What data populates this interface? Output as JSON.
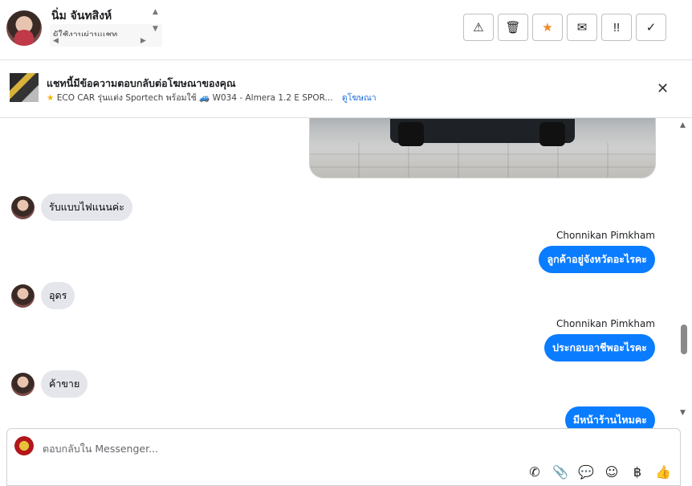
{
  "header": {
    "contact_name": "นิ่ม จันทสิงห์",
    "contact_subtext": "ผู้ใช้งานผ่านแชท",
    "actions": [
      {
        "name": "report-spam-button",
        "icon": "warning-icon",
        "glyph": "⚠"
      },
      {
        "name": "delete-button",
        "icon": "trash-icon",
        "glyph": "🗑"
      },
      {
        "name": "star-button",
        "icon": "star-icon",
        "glyph": "★"
      },
      {
        "name": "mark-unread-button",
        "icon": "envelope-open-icon",
        "glyph": "✉"
      },
      {
        "name": "follow-up-button",
        "icon": "follow-up-icon",
        "glyph": "!!"
      },
      {
        "name": "mark-done-button",
        "icon": "check-icon",
        "glyph": "✓"
      }
    ]
  },
  "ad_banner": {
    "title": "แชทนี้มีข้อความตอบกลับต่อโฆษณาของคุณ",
    "star_icon": "★",
    "ad_name": "ECO CAR รุ่นแต่ง Sportech พร้อมใช้",
    "car_icon": "🚙",
    "ad_detail": "W034 - Almera 1.2 E SPOR...",
    "link": "ดูโฆษณา",
    "close_glyph": "✕"
  },
  "messages": [
    {
      "direction": "in",
      "text": "รับแบบไฟแนนค่ะ"
    },
    {
      "direction": "out",
      "sender": "Chonnikan Pimkham",
      "text": "ลูกค้าอยู่จังหวัดอะไรคะ"
    },
    {
      "direction": "in",
      "text": "อุดร"
    },
    {
      "direction": "out",
      "sender": "Chonnikan Pimkham",
      "text": "ประกอบอาชีพอะไรคะ"
    },
    {
      "direction": "in",
      "text": "ค้าขาย"
    },
    {
      "direction": "out",
      "sender": "",
      "text": "มีหน้าร้านไหมคะ"
    }
  ],
  "composer": {
    "placeholder": "ตอบกลับใน Messenger...",
    "tools": [
      {
        "name": "call-icon",
        "glyph": "✆"
      },
      {
        "name": "attach-icon",
        "glyph": "📎"
      },
      {
        "name": "saved-replies-icon",
        "glyph": "💬"
      },
      {
        "name": "emoji-icon",
        "glyph": "☺"
      },
      {
        "name": "baht-icon",
        "glyph": "฿"
      },
      {
        "name": "like-icon",
        "glyph": "👍"
      }
    ]
  },
  "colors": {
    "accent": "#0a7cff",
    "incoming_bubble": "#e4e6eb",
    "star": "#f08a24"
  }
}
